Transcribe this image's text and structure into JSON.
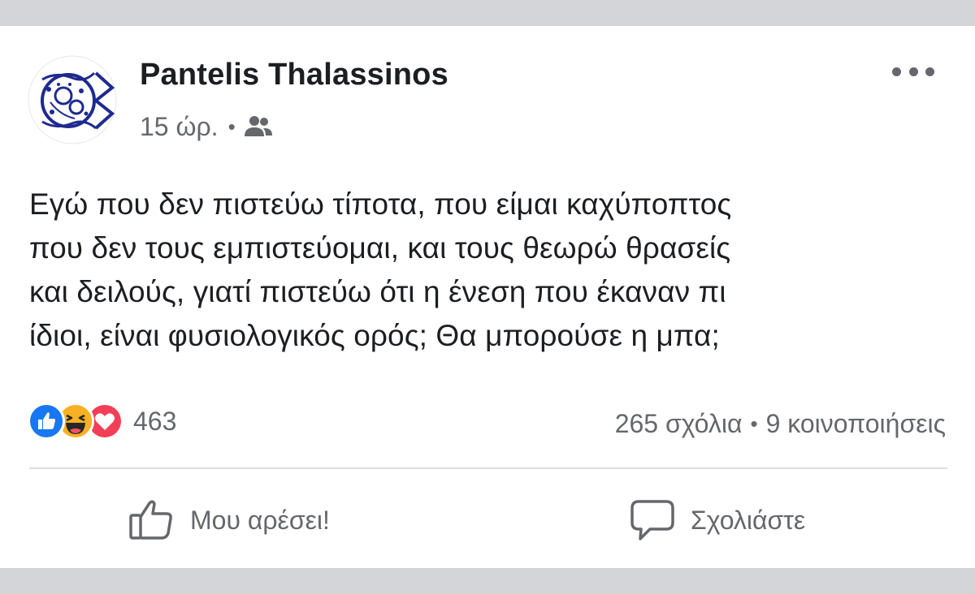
{
  "post": {
    "author": "Pantelis Thalassinos",
    "time": "15 ώρ.",
    "meta_separator": "•",
    "audience_icon": "friends-icon",
    "text_lines": [
      "Εγώ που δεν πιστεύω τίποτα, που είμαι καχύποπτος",
      "που δεν τους εμπιστεύομαι, και τους θεωρώ θρασείς",
      "και δειλούς, γιατί πιστεύω ότι η ένεση που έκαναν πι",
      "ίδιοι, είναι φυσιολογικός ορός; Θα μπορούσε η μπα;"
    ]
  },
  "reactions": {
    "icons": [
      "like-reaction-icon",
      "haha-reaction-icon",
      "love-reaction-icon"
    ],
    "count": "463"
  },
  "stats": {
    "comments": "265 σχόλια",
    "separator": "•",
    "shares": "9 κοινοποιήσεις"
  },
  "actions": {
    "like_label": "Μου αρέσει!",
    "comment_label": "Σχολιάστε"
  },
  "colors": {
    "like_blue": "#1877f2",
    "love_red": "#f33e58",
    "haha_yellow": "#f7b125",
    "secondary_text": "#65676b",
    "avatar_ink": "#1f2a8f"
  }
}
